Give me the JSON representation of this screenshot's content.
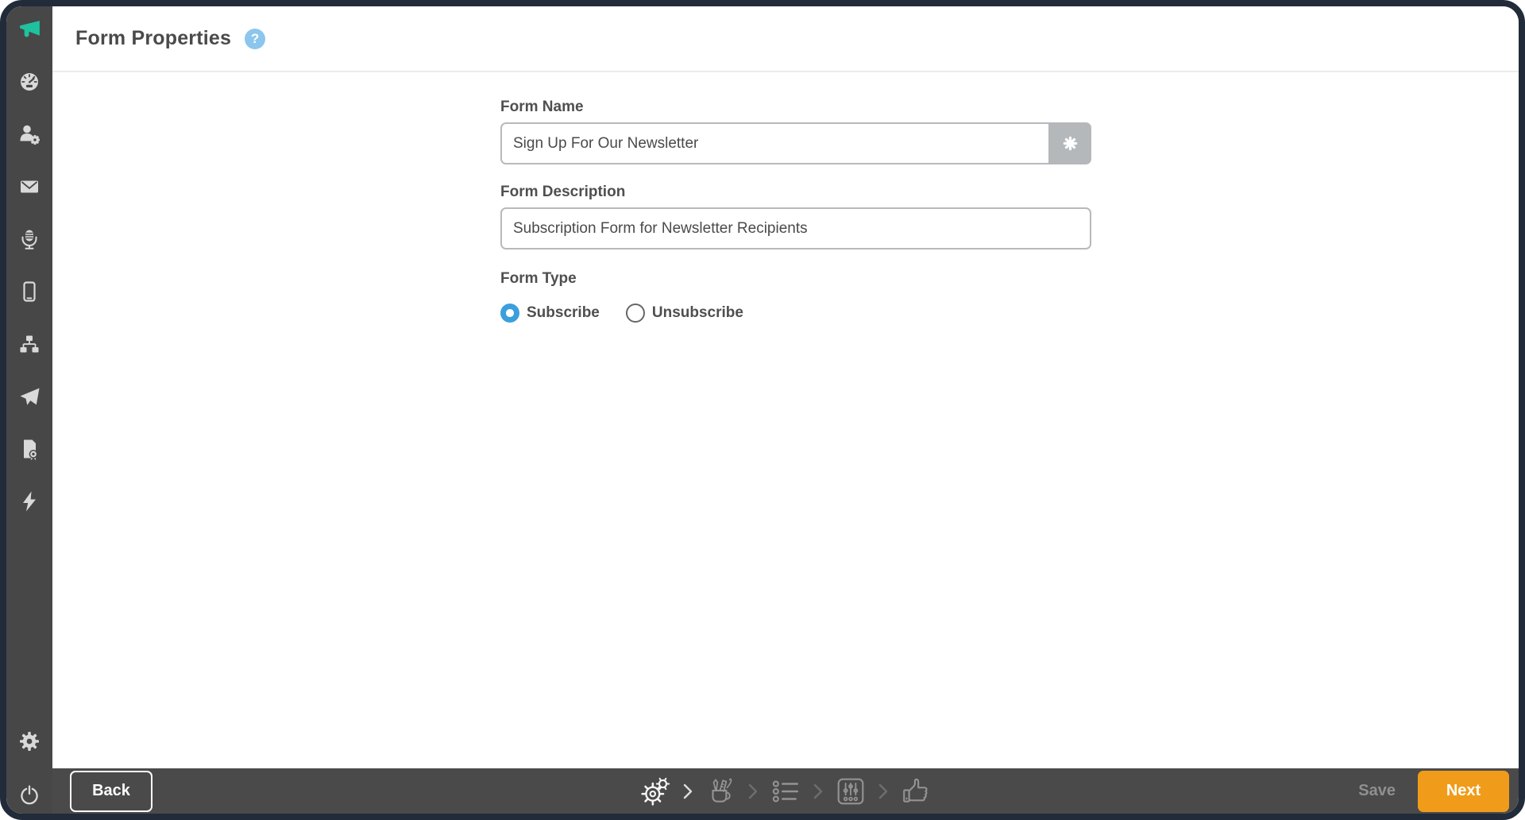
{
  "header": {
    "title": "Form Properties",
    "help_glyph": "?"
  },
  "form": {
    "name_label": "Form Name",
    "name_value": "Sign Up For Our Newsletter",
    "name_addon_icon": "asterisk-merge-field",
    "description_label": "Form Description",
    "description_value": "Subscription Form for Newsletter Recipients",
    "type_label": "Form Type",
    "type_options": [
      {
        "label": "Subscribe",
        "selected": true
      },
      {
        "label": "Unsubscribe",
        "selected": false
      }
    ]
  },
  "sidebar": {
    "logo_icon": "megaphone",
    "items": [
      {
        "icon": "dashboard-gauge"
      },
      {
        "icon": "contacts-person-gear"
      },
      {
        "icon": "email-envelope"
      },
      {
        "icon": "microphone"
      },
      {
        "icon": "mobile-phone"
      },
      {
        "icon": "sitemap"
      },
      {
        "icon": "send-paper-plane"
      },
      {
        "icon": "report-document-badge"
      },
      {
        "icon": "lightning-bolt"
      },
      {
        "icon": "settings-gear"
      },
      {
        "icon": "power"
      }
    ]
  },
  "footer": {
    "back_label": "Back",
    "save_label": "Save",
    "next_label": "Next",
    "steps": [
      {
        "icon": "setup-gears",
        "active": true
      },
      {
        "icon": "design-tools-mug",
        "active": false
      },
      {
        "icon": "fields-list",
        "active": false
      },
      {
        "icon": "options-sliders",
        "active": false
      },
      {
        "icon": "confirm-thumbs-up",
        "active": false
      }
    ]
  },
  "colors": {
    "frame_navy": "#212b39",
    "sidebar_gray": "#474747",
    "bottombar_gray": "#4a4a4a",
    "accent_teal": "#1ec29e",
    "help_blue": "#8cc6ed",
    "radio_blue": "#3b9fdd",
    "next_orange": "#f09c1a",
    "input_border": "#b9b9b9"
  }
}
